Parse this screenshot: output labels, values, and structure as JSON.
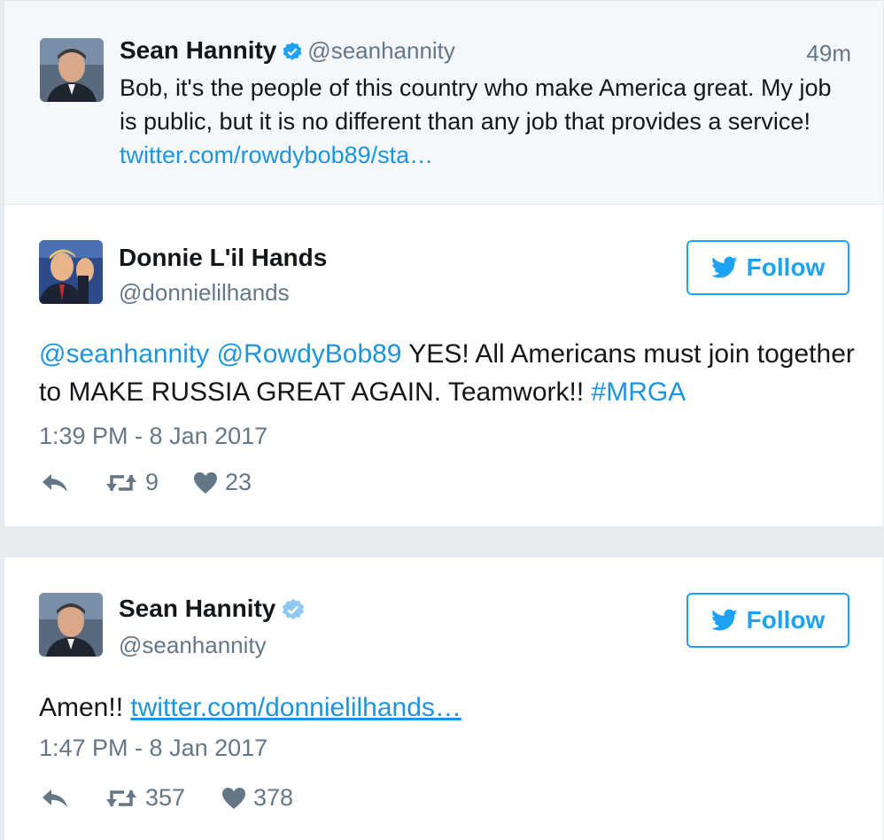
{
  "parent_tweet": {
    "name": "Sean Hannity",
    "handle": "@seanhannity",
    "time": "49m",
    "text": "Bob, it's the people of this country who make America great. My job is public, but it is no different than any job that provides a service!",
    "link": "twitter.com/rowdybob89/sta…"
  },
  "tweet1": {
    "name": "Donnie L'il Hands",
    "handle": "@donnielilhands",
    "follow_label": "Follow",
    "mention1": "@seanhannity",
    "mention2": "@RowdyBob89",
    "text": " YES! All Americans must join together to MAKE RUSSIA GREAT AGAIN. Teamwork!! ",
    "hashtag": "#MRGA",
    "timestamp": "1:39 PM - 8 Jan 2017",
    "retweets": "9",
    "likes": "23"
  },
  "tweet2": {
    "name": "Sean Hannity",
    "handle": "@seanhannity",
    "follow_label": "Follow",
    "text": "Amen!! ",
    "link": "twitter.com/donnielilhands…",
    "timestamp": "1:47 PM - 8 Jan 2017",
    "retweets": "357",
    "likes": "378"
  },
  "colors": {
    "twitter_blue": "#1da1f2",
    "link_blue": "#1b95e0",
    "verified_blue": "#1da1f2",
    "muted_gray": "#657786",
    "background": "#e6ecf0"
  },
  "icons": [
    "reply-icon",
    "retweet-icon",
    "like-icon",
    "verified-icon",
    "twitter-bird-icon"
  ]
}
